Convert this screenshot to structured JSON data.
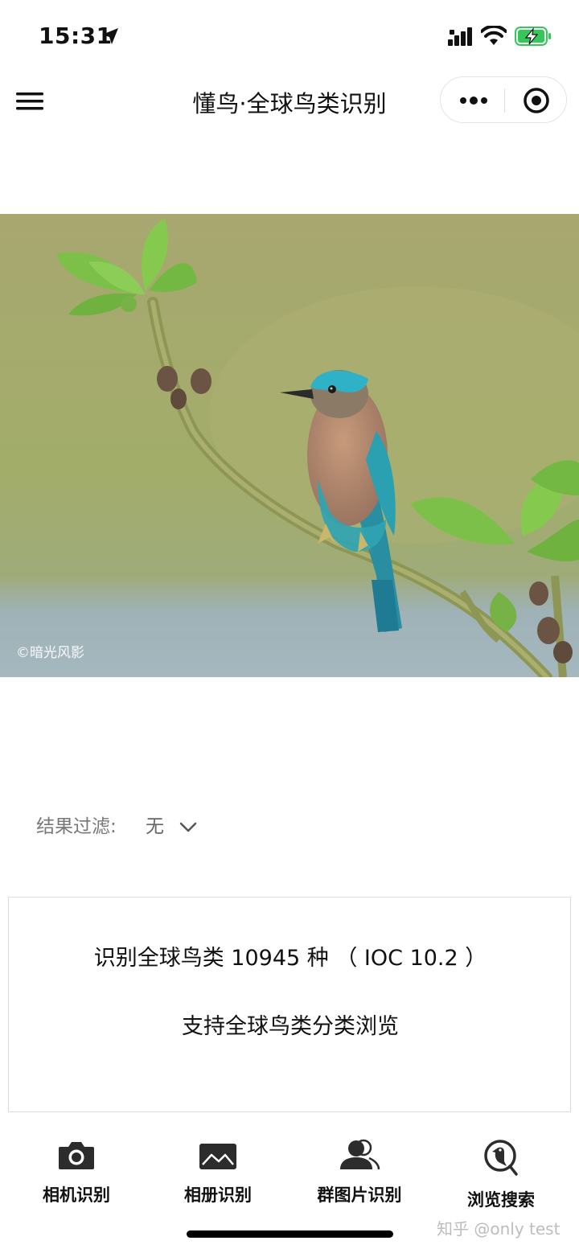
{
  "status_bar": {
    "time": "15:31",
    "icons": [
      "location-arrow-icon",
      "cellular-signal-icon",
      "wifi-icon",
      "battery-charging-icon"
    ]
  },
  "nav": {
    "title": "懂鸟·全球鸟类识别",
    "menu_icon": "hamburger-menu-icon",
    "capsule_icons": [
      "more-dots-icon",
      "target-circle-icon"
    ]
  },
  "hero": {
    "credit": "©暗光风影"
  },
  "filter": {
    "label": "结果过滤:",
    "value": "无"
  },
  "info": {
    "line1": "识别全球鸟类 10945 种 （ IOC 10.2 ）",
    "line2": "支持全球鸟类分类浏览"
  },
  "tabs": [
    {
      "label": "相机识别",
      "icon": "camera-icon"
    },
    {
      "label": "相册识别",
      "icon": "image-gallery-icon"
    },
    {
      "label": "群图片识别",
      "icon": "group-people-icon"
    },
    {
      "label": "浏览搜索",
      "icon": "bird-search-icon"
    }
  ],
  "watermark": "知乎 @only test",
  "colors": {
    "bird_teal": "#2a95a8",
    "bird_breast": "#b98a6e",
    "leaf_green": "#7cc04a",
    "background_olive": "#a9ad6c",
    "battery_green": "#35c759"
  }
}
